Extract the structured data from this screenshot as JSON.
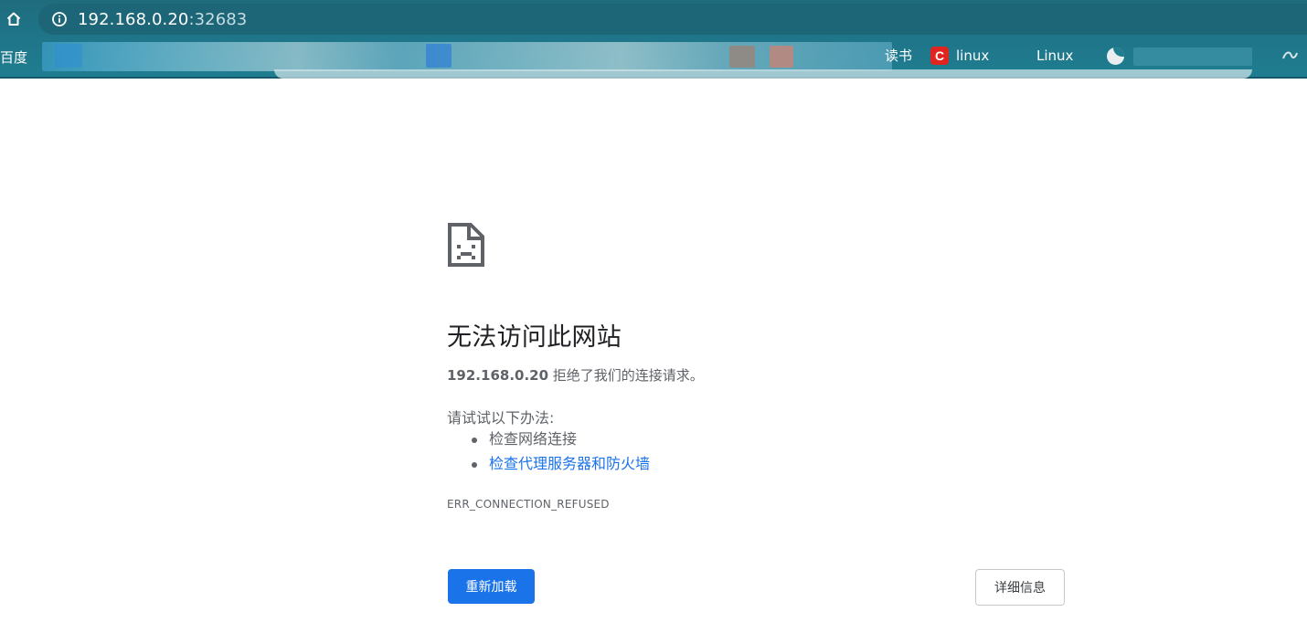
{
  "browser": {
    "url_host": "192.168.0.20",
    "url_port": ":32683",
    "bookmarks": {
      "first_label": "百度",
      "linux_label": "linux",
      "linux_site_label": "Linux",
      "partial_label": "读书"
    }
  },
  "error_page": {
    "title": "无法访问此网站",
    "host": "192.168.0.20",
    "summary_suffix": " 拒绝了我们的连接请求。",
    "suggestions_heading": "请试试以下办法:",
    "suggestions": [
      "检查网络连接",
      "检查代理服务器和防火墙"
    ],
    "error_code": "ERR_CONNECTION_REFUSED",
    "reload_button": "重新加载",
    "details_button": "详细信息"
  },
  "colors": {
    "chrome_bg": "#1f7488",
    "primary_button": "#1a73e8",
    "link": "#1a73e8",
    "body_text": "#5f6368"
  },
  "icons": {
    "home": "home-icon",
    "info": "info-icon",
    "error": "sad-document-icon"
  }
}
